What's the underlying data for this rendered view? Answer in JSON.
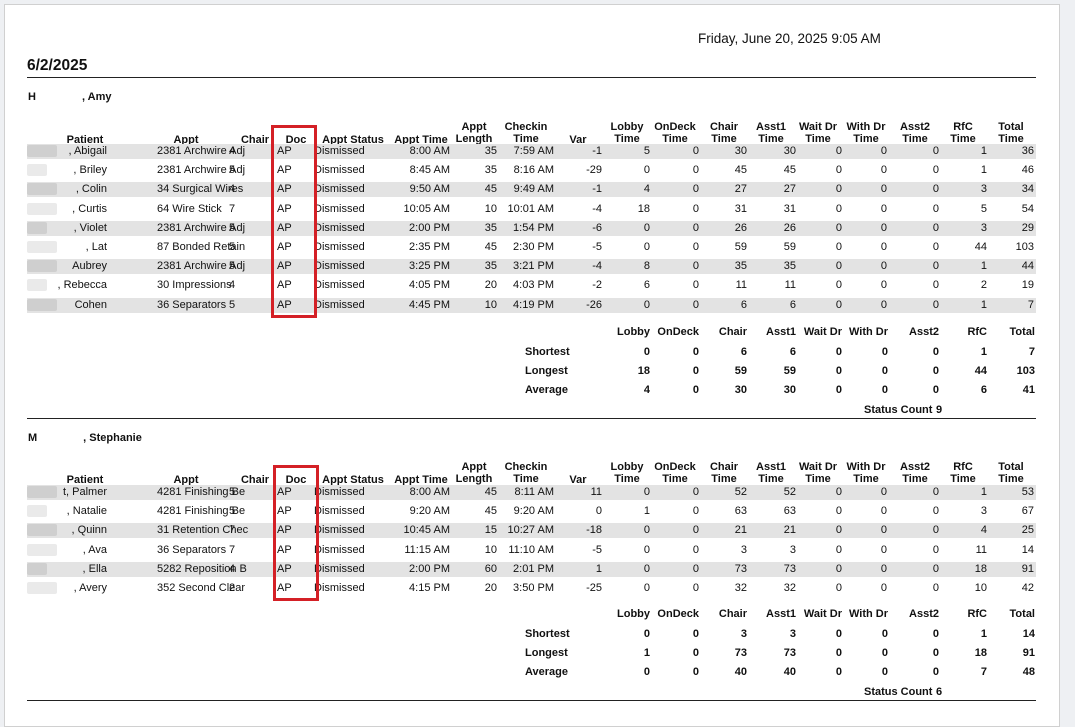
{
  "printed_at": "Friday, June 20, 2025 9:05 AM",
  "report_date": "6/2/2025",
  "columns": {
    "patient": "Patient",
    "appt": "Appt",
    "chair": "Chair",
    "doc": "Doc",
    "appt_status": "Appt Status",
    "appt_time": "Appt Time",
    "appt_length": [
      "Appt",
      "Length"
    ],
    "checkin_time": [
      "Checkin",
      "Time"
    ],
    "var": "Var",
    "lobby_time": [
      "Lobby",
      "Time"
    ],
    "ondeck_time": [
      "OnDeck",
      "Time"
    ],
    "chair_time": [
      "Chair",
      "Time"
    ],
    "asst1_time": [
      "Asst1",
      "Time"
    ],
    "wait_dr_time": [
      "Wait Dr",
      "Time"
    ],
    "with_dr_time": [
      "With Dr",
      "Time"
    ],
    "asst2_time": [
      "Asst2",
      "Time"
    ],
    "rfc_time": [
      "RfC",
      "Time"
    ],
    "total_time": [
      "Total",
      "Time"
    ]
  },
  "summary_columns": [
    "Lobby",
    "OnDeck",
    "Chair",
    "Asst1",
    "Wait Dr",
    "With Dr",
    "Asst2",
    "RfC",
    "Total"
  ],
  "summary_labels": {
    "shortest": "Shortest",
    "longest": "Longest",
    "average": "Average",
    "status_count": "Status Count"
  },
  "highlight_color": "#d42026",
  "providers": [
    {
      "initial": "H",
      "first_name": ", Amy",
      "rows": [
        {
          "patient": ", Abigail",
          "appt": "2381 Archwire Adj",
          "chair": "4",
          "doc": "AP",
          "status": "Dismissed",
          "time": "8:00 AM",
          "length": "35",
          "checkin": "7:59 AM",
          "var": "-1",
          "lobby": "5",
          "ondeck": "0",
          "chairt": "30",
          "asst1": "30",
          "waitdr": "0",
          "withdr": "0",
          "asst2": "0",
          "rfc": "1",
          "total": "36"
        },
        {
          "patient": ", Briley",
          "appt": "2381 Archwire Adj",
          "chair": "5",
          "doc": "AP",
          "status": "Dismissed",
          "time": "8:45 AM",
          "length": "35",
          "checkin": "8:16 AM",
          "var": "-29",
          "lobby": "0",
          "ondeck": "0",
          "chairt": "45",
          "asst1": "45",
          "waitdr": "0",
          "withdr": "0",
          "asst2": "0",
          "rfc": "1",
          "total": "46"
        },
        {
          "patient": ", Colin",
          "appt": "34 Surgical Wires",
          "chair": "4",
          "doc": "AP",
          "status": "Dismissed",
          "time": "9:50 AM",
          "length": "45",
          "checkin": "9:49 AM",
          "var": "-1",
          "lobby": "4",
          "ondeck": "0",
          "chairt": "27",
          "asst1": "27",
          "waitdr": "0",
          "withdr": "0",
          "asst2": "0",
          "rfc": "3",
          "total": "34"
        },
        {
          "patient": ", Curtis",
          "appt": "64 Wire Stick",
          "chair": "7",
          "doc": "AP",
          "status": "Dismissed",
          "time": "10:05 AM",
          "length": "10",
          "checkin": "10:01 AM",
          "var": "-4",
          "lobby": "18",
          "ondeck": "0",
          "chairt": "31",
          "asst1": "31",
          "waitdr": "0",
          "withdr": "0",
          "asst2": "0",
          "rfc": "5",
          "total": "54"
        },
        {
          "patient": ", Violet",
          "appt": "2381 Archwire Adj",
          "chair": "5",
          "doc": "AP",
          "status": "Dismissed",
          "time": "2:00 PM",
          "length": "35",
          "checkin": "1:54 PM",
          "var": "-6",
          "lobby": "0",
          "ondeck": "0",
          "chairt": "26",
          "asst1": "26",
          "waitdr": "0",
          "withdr": "0",
          "asst2": "0",
          "rfc": "3",
          "total": "29"
        },
        {
          "patient": ", Lat",
          "appt": "87 Bonded Retain",
          "chair": "5",
          "doc": "AP",
          "status": "Dismissed",
          "time": "2:35 PM",
          "length": "45",
          "checkin": "2:30 PM",
          "var": "-5",
          "lobby": "0",
          "ondeck": "0",
          "chairt": "59",
          "asst1": "59",
          "waitdr": "0",
          "withdr": "0",
          "asst2": "0",
          "rfc": "44",
          "total": "103"
        },
        {
          "patient": "Aubrey",
          "appt": "2381 Archwire Adj",
          "chair": "5",
          "doc": "AP",
          "status": "Dismissed",
          "time": "3:25 PM",
          "length": "35",
          "checkin": "3:21 PM",
          "var": "-4",
          "lobby": "8",
          "ondeck": "0",
          "chairt": "35",
          "asst1": "35",
          "waitdr": "0",
          "withdr": "0",
          "asst2": "0",
          "rfc": "1",
          "total": "44"
        },
        {
          "patient": ", Rebecca",
          "appt": "30 Impressions",
          "chair": "4",
          "doc": "AP",
          "status": "Dismissed",
          "time": "4:05 PM",
          "length": "20",
          "checkin": "4:03 PM",
          "var": "-2",
          "lobby": "6",
          "ondeck": "0",
          "chairt": "11",
          "asst1": "11",
          "waitdr": "0",
          "withdr": "0",
          "asst2": "0",
          "rfc": "2",
          "total": "19"
        },
        {
          "patient": "Cohen",
          "appt": "36 Separators",
          "chair": "5",
          "doc": "AP",
          "status": "Dismissed",
          "time": "4:45 PM",
          "length": "10",
          "checkin": "4:19 PM",
          "var": "-26",
          "lobby": "0",
          "ondeck": "0",
          "chairt": "6",
          "asst1": "6",
          "waitdr": "0",
          "withdr": "0",
          "asst2": "0",
          "rfc": "1",
          "total": "7"
        }
      ],
      "summary": {
        "shortest": [
          "0",
          "0",
          "6",
          "6",
          "0",
          "0",
          "0",
          "1",
          "7"
        ],
        "longest": [
          "18",
          "0",
          "59",
          "59",
          "0",
          "0",
          "0",
          "44",
          "103"
        ],
        "average": [
          "4",
          "0",
          "30",
          "30",
          "0",
          "0",
          "0",
          "6",
          "41"
        ],
        "status_count": "9"
      }
    },
    {
      "initial": "M",
      "first_name": ", Stephanie",
      "rows": [
        {
          "patient": "t, Palmer",
          "appt": "4281 Finishing Be",
          "chair": "5",
          "doc": "AP",
          "status": "Dismissed",
          "time": "8:00 AM",
          "length": "45",
          "checkin": "8:11 AM",
          "var": "11",
          "lobby": "0",
          "ondeck": "0",
          "chairt": "52",
          "asst1": "52",
          "waitdr": "0",
          "withdr": "0",
          "asst2": "0",
          "rfc": "1",
          "total": "53"
        },
        {
          "patient": ", Natalie",
          "appt": "4281 Finishing Be",
          "chair": "5",
          "doc": "AP",
          "status": "Dismissed",
          "time": "9:20 AM",
          "length": "45",
          "checkin": "9:20 AM",
          "var": "0",
          "lobby": "1",
          "ondeck": "0",
          "chairt": "63",
          "asst1": "63",
          "waitdr": "0",
          "withdr": "0",
          "asst2": "0",
          "rfc": "3",
          "total": "67"
        },
        {
          "patient": ", Quinn",
          "appt": "31 Retention Chec",
          "chair": "7",
          "doc": "AP",
          "status": "Dismissed",
          "time": "10:45 AM",
          "length": "15",
          "checkin": "10:27 AM",
          "var": "-18",
          "lobby": "0",
          "ondeck": "0",
          "chairt": "21",
          "asst1": "21",
          "waitdr": "0",
          "withdr": "0",
          "asst2": "0",
          "rfc": "4",
          "total": "25"
        },
        {
          "patient": ", Ava",
          "appt": "36 Separators",
          "chair": "7",
          "doc": "AP",
          "status": "Dismissed",
          "time": "11:15 AM",
          "length": "10",
          "checkin": "11:10 AM",
          "var": "-5",
          "lobby": "0",
          "ondeck": "0",
          "chairt": "3",
          "asst1": "3",
          "waitdr": "0",
          "withdr": "0",
          "asst2": "0",
          "rfc": "11",
          "total": "14"
        },
        {
          "patient": ", Ella",
          "appt": "5282 Reposition B",
          "chair": "4",
          "doc": "AP",
          "status": "Dismissed",
          "time": "2:00 PM",
          "length": "60",
          "checkin": "2:01 PM",
          "var": "1",
          "lobby": "0",
          "ondeck": "0",
          "chairt": "73",
          "asst1": "73",
          "waitdr": "0",
          "withdr": "0",
          "asst2": "0",
          "rfc": "18",
          "total": "91"
        },
        {
          "patient": ", Avery",
          "appt": "352 Second Clear",
          "chair": "2",
          "doc": "AP",
          "status": "Dismissed",
          "time": "4:15 PM",
          "length": "20",
          "checkin": "3:50 PM",
          "var": "-25",
          "lobby": "0",
          "ondeck": "0",
          "chairt": "32",
          "asst1": "32",
          "waitdr": "0",
          "withdr": "0",
          "asst2": "0",
          "rfc": "10",
          "total": "42"
        }
      ],
      "summary": {
        "shortest": [
          "0",
          "0",
          "3",
          "3",
          "0",
          "0",
          "0",
          "1",
          "14"
        ],
        "longest": [
          "1",
          "0",
          "73",
          "73",
          "0",
          "0",
          "0",
          "18",
          "91"
        ],
        "average": [
          "0",
          "0",
          "40",
          "40",
          "0",
          "0",
          "0",
          "7",
          "48"
        ],
        "status_count": "6"
      }
    }
  ]
}
